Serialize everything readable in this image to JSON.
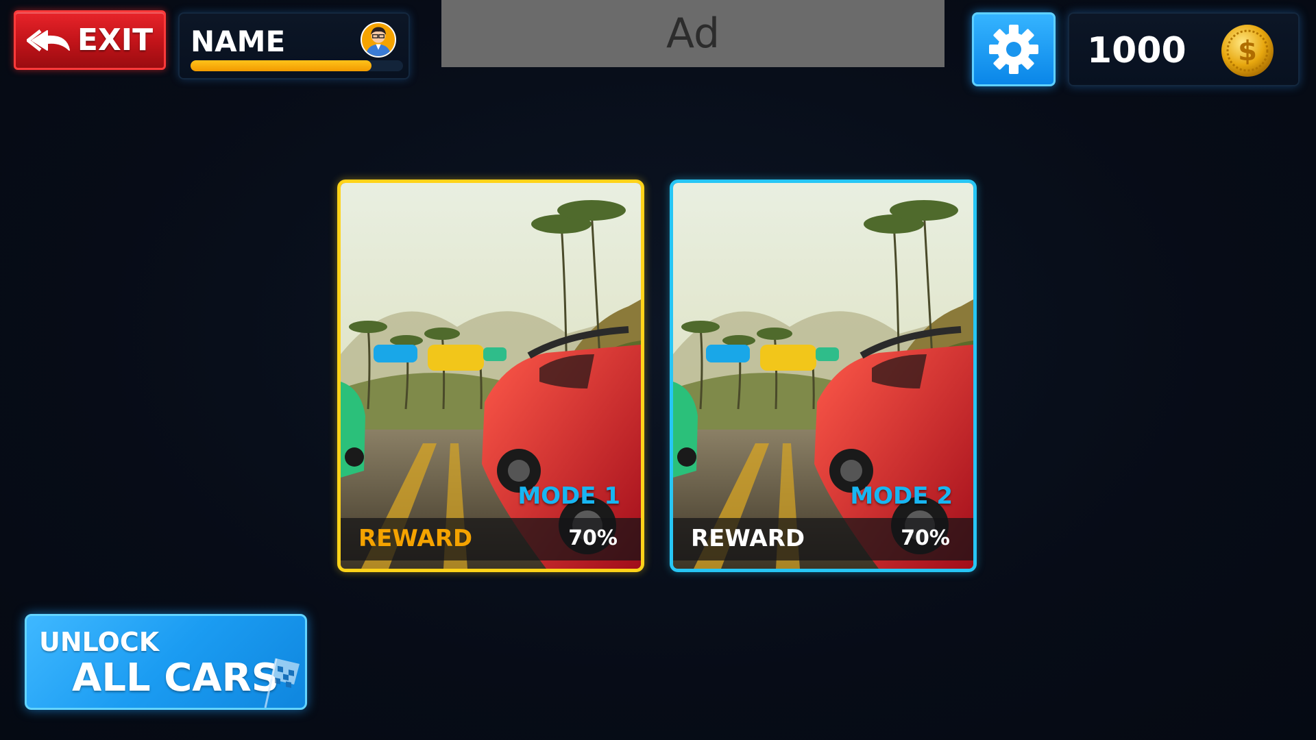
{
  "header": {
    "exit_label": "EXIT",
    "player_name": "NAME",
    "xp_progress_percent": 85,
    "ad_label": "Ad",
    "coins": "1000"
  },
  "modes": [
    {
      "label": "MODE 1",
      "reward_label": "REWARD",
      "reward_value": "70%",
      "border_color": "#ffd319",
      "reward_label_color": "#f5a300"
    },
    {
      "label": "MODE 2",
      "reward_label": "REWARD",
      "reward_value": "70%",
      "border_color": "#27c6f5",
      "reward_label_color": "#ffffff"
    }
  ],
  "unlock": {
    "line1": "UNLOCK",
    "line2": "ALL CARS"
  },
  "colors": {
    "background": "#070d18",
    "exit_red": "#d01a20",
    "accent_blue": "#1b9cf2",
    "gold": "#f5a300"
  },
  "icons": [
    "back-arrow-icon",
    "avatar-icon",
    "gear-icon",
    "coin-icon",
    "checkered-flag-icon"
  ]
}
